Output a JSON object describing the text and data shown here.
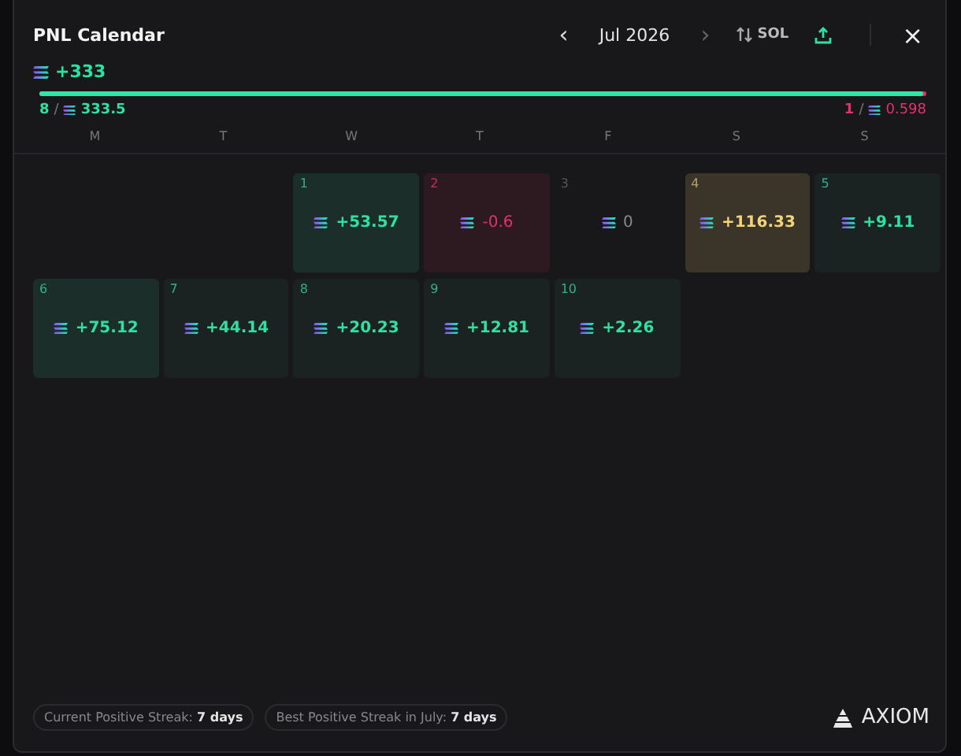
{
  "window": {
    "title": "PNL Calendar",
    "month": "Jul 2026",
    "prev": "‹",
    "next": "›",
    "currency": "SOL",
    "close": "×"
  },
  "summary": {
    "total": "+333",
    "level": 0.997,
    "wins": "8",
    "win_amount": "333.5",
    "losses": "1",
    "loss_amount": "0.598",
    "separator": "/"
  },
  "weekdays": [
    "M",
    "T",
    "W",
    "T",
    "F",
    "S",
    "S"
  ],
  "days": [
    {
      "kind": "blank"
    },
    {
      "kind": "blank"
    },
    {
      "day": "1",
      "value": "+53.57",
      "kind": "strong"
    },
    {
      "day": "2",
      "value": "-0.6",
      "kind": "loss"
    },
    {
      "day": "3",
      "value": "0",
      "kind": "flat"
    },
    {
      "day": "4",
      "value": "+116.33",
      "kind": "top"
    },
    {
      "day": "5",
      "value": "+9.11",
      "kind": "gain"
    },
    {
      "day": "6",
      "value": "+75.12",
      "kind": "strong"
    },
    {
      "day": "7",
      "value": "+44.14",
      "kind": "gain"
    },
    {
      "day": "8",
      "value": "+20.23",
      "kind": "gain"
    },
    {
      "day": "9",
      "value": "+12.81",
      "kind": "gain"
    },
    {
      "day": "10",
      "value": "+2.26",
      "kind": "gain"
    }
  ],
  "streaks": [
    "Current Positive Streak: **7 days**",
    "Best Positive Streak in July: **7 days**"
  ],
  "brand": "AXIOM"
}
